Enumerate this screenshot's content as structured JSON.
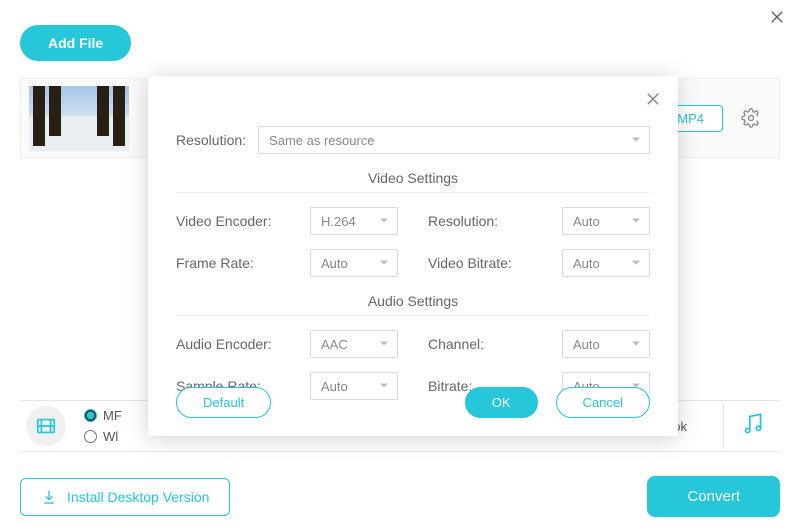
{
  "toolbar": {
    "add_file": "Add File"
  },
  "file_row": {
    "format": "MP4"
  },
  "tabs": {
    "radio1_prefix": "MF",
    "radio2_prefix": "Wl",
    "right_partial": "ok"
  },
  "footer": {
    "install": "Install Desktop Version",
    "convert": "Convert"
  },
  "modal": {
    "resolution_label": "Resolution:",
    "resolution_value": "Same as resource",
    "video_section": "Video Settings",
    "audio_section": "Audio Settings",
    "video": {
      "encoder_label": "Video Encoder:",
      "encoder_value": "H.264",
      "resolution_label": "Resolution:",
      "resolution_value": "Auto",
      "frame_rate_label": "Frame Rate:",
      "frame_rate_value": "Auto",
      "bitrate_label": "Video Bitrate:",
      "bitrate_value": "Auto"
    },
    "audio": {
      "encoder_label": "Audio Encoder:",
      "encoder_value": "AAC",
      "channel_label": "Channel:",
      "channel_value": "Auto",
      "sample_rate_label": "Sample Rate:",
      "sample_rate_value": "Auto",
      "bitrate_label": "Bitrate:",
      "bitrate_value": "Auto"
    },
    "buttons": {
      "default": "Default",
      "ok": "OK",
      "cancel": "Cancel"
    }
  }
}
